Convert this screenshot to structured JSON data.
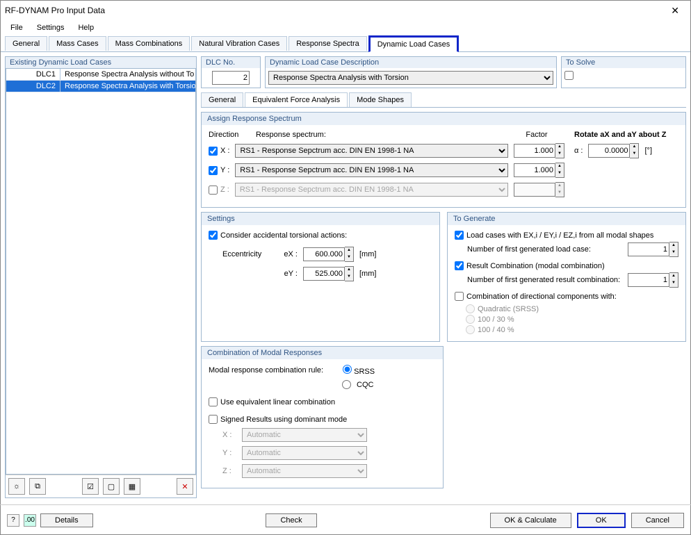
{
  "window": {
    "title": "RF-DYNAM Pro Input Data"
  },
  "menu": {
    "file": "File",
    "settings": "Settings",
    "help": "Help"
  },
  "tabs": {
    "general": "General",
    "massCases": "Mass Cases",
    "massComb": "Mass Combinations",
    "natural": "Natural Vibration Cases",
    "response": "Response Spectra",
    "dynamic": "Dynamic Load Cases"
  },
  "leftPanel": {
    "title": "Existing Dynamic Load Cases",
    "rows": [
      {
        "id": "DLC1",
        "desc": "Response Spectra Analysis without To"
      },
      {
        "id": "DLC2",
        "desc": "Response Spectra Analysis with Torsio"
      }
    ]
  },
  "dlcNo": {
    "title": "DLC No.",
    "value": "2"
  },
  "dlcDesc": {
    "title": "Dynamic Load Case Description",
    "value": "Response Spectra Analysis with Torsion"
  },
  "toSolve": {
    "title": "To Solve"
  },
  "subtabs": {
    "general": "General",
    "efa": "Equivalent Force Analysis",
    "mode": "Mode Shapes"
  },
  "assign": {
    "title": "Assign Response Spectrum",
    "direction": "Direction",
    "spectrum": "Response spectrum:",
    "factor": "Factor",
    "rotate": "Rotate aX and aY about Z",
    "alpha": "α :",
    "alphaVal": "0.0000",
    "unit": "[°]",
    "x": "X :",
    "y": "Y :",
    "z": "Z :",
    "rs": "RS1 - Response Sepctrum acc. DIN EN 1998-1 NA",
    "factorVal": "1.000"
  },
  "settings": {
    "title": "Settings",
    "torsion": "Consider accidental torsional actions:",
    "ecc": "Eccentricity",
    "ex": "eX :",
    "exVal": "600.000",
    "exUnit": "[mm]",
    "ey": "eY :",
    "eyVal": "525.000",
    "eyUnit": "[mm]"
  },
  "generate": {
    "title": "To Generate",
    "loadCases": "Load cases with EX,i / EY,i / EZ,i from all modal shapes",
    "numFirst": "Number of first generated load case:",
    "numFirstVal": "1",
    "resultComb": "Result Combination (modal combination)",
    "numResult": "Number of first generated result combination:",
    "numResultVal": "1",
    "dirComb": "Combination of directional components with:",
    "quad": "Quadratic (SRSS)",
    "r30": "100 / 30 %",
    "r40": "100 / 40 %"
  },
  "modalComb": {
    "title": "Combination of Modal Responses",
    "rule": "Modal response combination rule:",
    "srss": "SRSS",
    "cqc": "CQC",
    "linear": "Use equivalent linear combination",
    "signed": "Signed Results using dominant mode",
    "x": "X :",
    "y": "Y :",
    "z": "Z :",
    "auto": "Automatic"
  },
  "footer": {
    "details": "Details",
    "check": "Check",
    "okCalc": "OK & Calculate",
    "ok": "OK",
    "cancel": "Cancel"
  }
}
